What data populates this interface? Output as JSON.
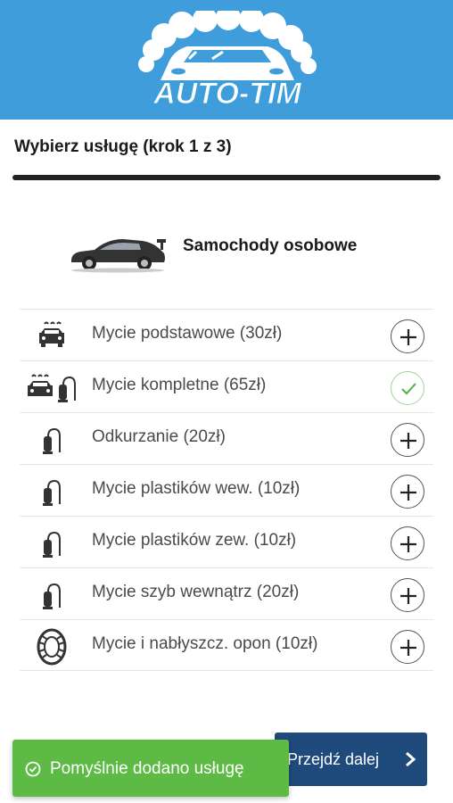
{
  "brand": {
    "name": "AUTO-TIM",
    "header_color": "#3f9ddb"
  },
  "step": {
    "title": "Wybierz usługę (krok 1 z 3)"
  },
  "category": {
    "label": "Samochody osobowe",
    "icon": "sports-car-icon"
  },
  "services": [
    {
      "label": "Mycie podstawowe (30zł)",
      "icon": "car-wash-icon",
      "selected": false
    },
    {
      "label": "Mycie kompletne (65zł)",
      "icon": "car-wash-vacuum-icon",
      "selected": true
    },
    {
      "label": "Odkurzanie (20zł)",
      "icon": "vacuum-icon",
      "selected": false
    },
    {
      "label": "Mycie plastików wew. (10zł)",
      "icon": "vacuum-icon",
      "selected": false
    },
    {
      "label": "Mycie plastików zew. (10zł)",
      "icon": "vacuum-icon",
      "selected": false
    },
    {
      "label": "Mycie szyb wewnątrz (20zł)",
      "icon": "vacuum-icon",
      "selected": false
    },
    {
      "label": "Mycie i nabłyszcz. opon (10zł)",
      "icon": "tire-icon",
      "selected": false
    }
  ],
  "next_button": {
    "label": "Przejdź dalej",
    "icon": "chevron-right-icon",
    "color": "#1f4a7c"
  },
  "toast": {
    "message": "Pomyślnie dodano usługę",
    "icon": "check-circle-icon",
    "color": "#5dbb45"
  }
}
